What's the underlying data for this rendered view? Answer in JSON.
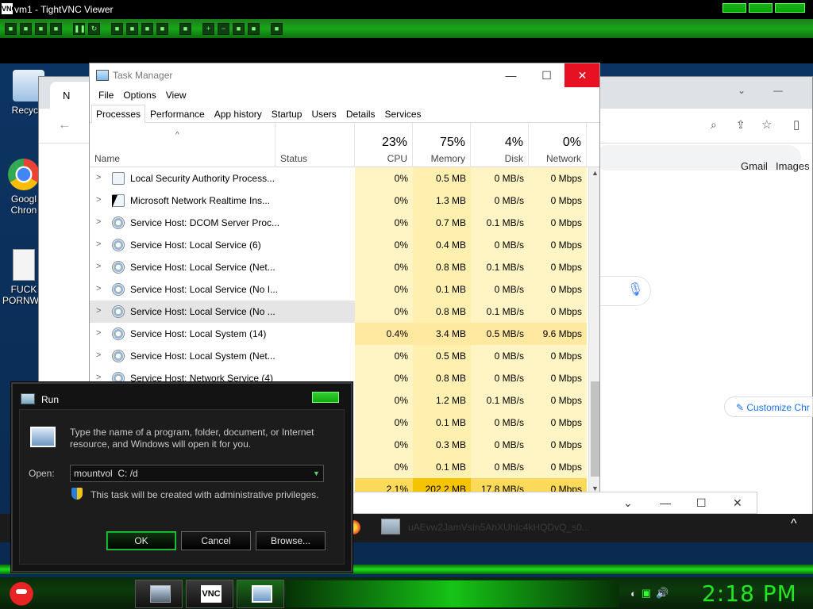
{
  "vnc": {
    "title": "vm1 - TightVNC Viewer",
    "icon_label": "VNC"
  },
  "desktop": {
    "icons": [
      {
        "label": "Recycle",
        "icon": "recycle-bin-icon"
      },
      {
        "label": "Googl Chron",
        "icon": "chrome-icon"
      },
      {
        "label": "FUCK PORNWE",
        "icon": "document-icon"
      }
    ]
  },
  "chrome": {
    "tab_initial": "N",
    "links": [
      "Gmail",
      "Images"
    ],
    "customize": "Customize Chr"
  },
  "task_manager": {
    "title": "Task Manager",
    "menu": [
      "File",
      "Options",
      "View"
    ],
    "tabs": [
      "Processes",
      "Performance",
      "App history",
      "Startup",
      "Users",
      "Details",
      "Services"
    ],
    "active_tab": "Processes",
    "columns": {
      "name": "Name",
      "status": "Status",
      "cpu": {
        "pct": "23%",
        "label": "CPU"
      },
      "memory": {
        "pct": "75%",
        "label": "Memory"
      },
      "disk": {
        "pct": "4%",
        "label": "Disk"
      },
      "network": {
        "pct": "0%",
        "label": "Network"
      }
    },
    "rows": [
      {
        "name": "Local Security Authority Process...",
        "icon": "app-window-icon",
        "cpu": "0%",
        "mem": "0.5 MB",
        "disk": "0 MB/s",
        "net": "0 Mbps"
      },
      {
        "name": "Microsoft Network Realtime Ins...",
        "icon": "app-window-icon",
        "cpu": "0%",
        "mem": "1.3 MB",
        "disk": "0 MB/s",
        "net": "0 Mbps"
      },
      {
        "name": "Service Host: DCOM Server Proc...",
        "icon": "gear-icon",
        "cpu": "0%",
        "mem": "0.7 MB",
        "disk": "0.1 MB/s",
        "net": "0 Mbps"
      },
      {
        "name": "Service Host: Local Service (6)",
        "icon": "gear-icon",
        "cpu": "0%",
        "mem": "0.4 MB",
        "disk": "0 MB/s",
        "net": "0 Mbps"
      },
      {
        "name": "Service Host: Local Service (Net...",
        "icon": "gear-icon",
        "cpu": "0%",
        "mem": "0.8 MB",
        "disk": "0.1 MB/s",
        "net": "0 Mbps"
      },
      {
        "name": "Service Host: Local Service (No I...",
        "icon": "gear-icon",
        "cpu": "0%",
        "mem": "0.1 MB",
        "disk": "0 MB/s",
        "net": "0 Mbps"
      },
      {
        "name": "Service Host: Local Service (No ...",
        "icon": "gear-icon",
        "cpu": "0%",
        "mem": "0.8 MB",
        "disk": "0.1 MB/s",
        "net": "0 Mbps"
      },
      {
        "name": "Service Host: Local System (14)",
        "icon": "gear-icon",
        "cpu": "0.4%",
        "mem": "3.4 MB",
        "disk": "0.5 MB/s",
        "net": "9.6 Mbps"
      },
      {
        "name": "Service Host: Local System (Net...",
        "icon": "gear-icon",
        "cpu": "0%",
        "mem": "0.5 MB",
        "disk": "0 MB/s",
        "net": "0 Mbps"
      },
      {
        "name": "Service Host: Network Service (4)",
        "icon": "gear-icon",
        "cpu": "0%",
        "mem": "0.8 MB",
        "disk": "0 MB/s",
        "net": "0 Mbps"
      },
      {
        "name": "",
        "icon": "",
        "cpu": "0%",
        "mem": "1.2 MB",
        "disk": "0.1 MB/s",
        "net": "0 Mbps"
      },
      {
        "name": "",
        "icon": "",
        "cpu": "0%",
        "mem": "0.1 MB",
        "disk": "0 MB/s",
        "net": "0 Mbps"
      },
      {
        "name": "",
        "icon": "",
        "cpu": "0%",
        "mem": "0.3 MB",
        "disk": "0 MB/s",
        "net": "0 Mbps"
      },
      {
        "name": "",
        "icon": "",
        "cpu": "0%",
        "mem": "0.1 MB",
        "disk": "0 MB/s",
        "net": "0 Mbps"
      },
      {
        "name": "",
        "icon": "",
        "cpu": "2.1%",
        "mem": "202.2 MB",
        "disk": "17.8 MB/s",
        "net": "0 Mbps"
      }
    ]
  },
  "run": {
    "title": "Run",
    "description": "Type the name of a program, folder, document, or Internet resource, and Windows will open it for you.",
    "open_label": "Open:",
    "input_value": "mountvol  C: /d",
    "admin_note": "This task will be created with administrative privileges.",
    "ok": "OK",
    "cancel": "Cancel",
    "browse": "Browse..."
  },
  "band": {
    "url_fragment": "uAEvw2JamVsIn5AhXUhIc4kHQDvQ_s0..."
  },
  "taskbar": {
    "clock": "2:18 PM",
    "vnc_app": "VNC"
  },
  "colors": {
    "accent_green": "#1ee01e",
    "clock_green": "#22e622",
    "close_red": "#e81123"
  }
}
